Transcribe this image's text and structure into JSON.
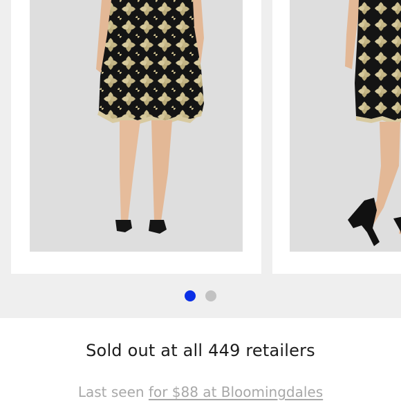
{
  "carousel": {
    "slides": [
      {
        "alt": "skirt-front-photo"
      },
      {
        "alt": "skirt-side-photo"
      }
    ],
    "active_index": 0,
    "colors": {
      "active_dot": "#0a2fe6",
      "inactive_dot": "#c2c2c2"
    }
  },
  "availability": {
    "status": "Sold out at all 449 retailers",
    "last_seen_prefix": "Last seen",
    "last_seen_link": "for $88 at Bloomingdales"
  }
}
